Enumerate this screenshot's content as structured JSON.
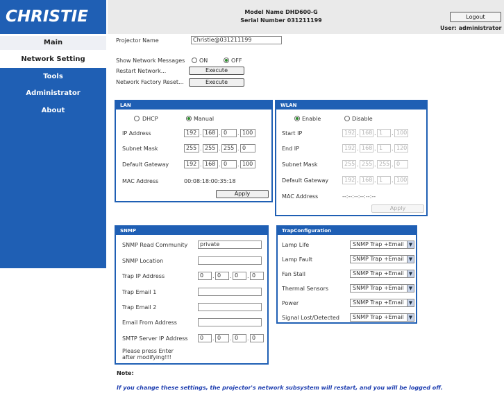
{
  "brand": {
    "logo": "CHRISTIE",
    "accent": "#1f5fb4"
  },
  "header": {
    "model_name": "Model Name DHD600-G",
    "serial_number": "Serial Number 031211199",
    "logout_label": "Logout",
    "user_text": "User: administrator"
  },
  "sidebar": {
    "items": [
      {
        "label": "Main"
      },
      {
        "label": "Network Setting"
      },
      {
        "label": "Tools"
      },
      {
        "label": "Administrator"
      },
      {
        "label": "About"
      }
    ]
  },
  "general": {
    "projector_name_label": "Projector Name",
    "projector_name_value": "Christie@031211199",
    "show_messages_label": "Show Network Messages",
    "on_label": "ON",
    "off_label": "OFF",
    "show_messages_selected": "OFF",
    "restart_label": "Restart Network...",
    "factory_reset_label": "Network Factory Reset...",
    "execute_label": "Execute"
  },
  "lan": {
    "title": "LAN",
    "dhcp_label": "DHCP",
    "manual_label": "Manual",
    "mode_selected": "Manual",
    "ip_label": "IP Address",
    "ip": [
      "192",
      "168",
      "0",
      "100"
    ],
    "mask_label": "Subnet Mask",
    "mask": [
      "255",
      "255",
      "255",
      "0"
    ],
    "gateway_label": "Default Gateway",
    "gateway": [
      "192",
      "168",
      "0",
      "100"
    ],
    "mac_label": "MAC Address",
    "mac_value": "00:08:18:00:35:18",
    "apply_label": "Apply"
  },
  "wlan": {
    "title": "WLAN",
    "enable_label": "Enable",
    "disable_label": "Disable",
    "selected": "Enable",
    "start_ip_label": "Start IP",
    "start_ip": [
      "192",
      "168",
      "1",
      "100"
    ],
    "end_ip_label": "End IP",
    "end_ip": [
      "192",
      "168",
      "1",
      "120"
    ],
    "mask_label": "Subnet Mask",
    "mask": [
      "255",
      "255",
      "255",
      "0"
    ],
    "gateway_label": "Default Gateway",
    "gateway": [
      "192",
      "168",
      "1",
      "100"
    ],
    "mac_label": "MAC Address",
    "mac_value": "--:--:--:--:--:--",
    "apply_label": "Apply"
  },
  "snmp": {
    "title": "SNMP",
    "read_community_label": "SNMP Read Community",
    "read_community_value": "private",
    "location_label": "SNMP Location",
    "location_value": "",
    "trap_ip_label": "Trap IP Address",
    "trap_ip": [
      "0",
      "0",
      "0",
      "0"
    ],
    "trap_email1_label": "Trap Email 1",
    "trap_email2_label": "Trap Email 2",
    "email_from_label": "Email From Address",
    "smtp_label": "SMTP Server IP Address",
    "smtp_ip": [
      "0",
      "0",
      "0",
      "0"
    ],
    "hint_line1": "Please press Enter",
    "hint_line2": "after modifying!!!"
  },
  "trap": {
    "title": "TrapConfiguration",
    "rows": [
      {
        "label": "Lamp Life",
        "value": "SNMP Trap +Email"
      },
      {
        "label": "Lamp Fault",
        "value": "SNMP Trap +Email"
      },
      {
        "label": "Fan Stall",
        "value": "SNMP Trap +Email"
      },
      {
        "label": "Thermal Sensors",
        "value": "SNMP Trap +Email"
      },
      {
        "label": "Power",
        "value": "SNMP Trap +Email"
      },
      {
        "label": "Signal Lost/Detected",
        "value": "SNMP Trap +Email"
      }
    ]
  },
  "note": {
    "title": "Note:",
    "text": "If you change these settings, the projector's network subsystem will restart, and you will be logged off."
  }
}
